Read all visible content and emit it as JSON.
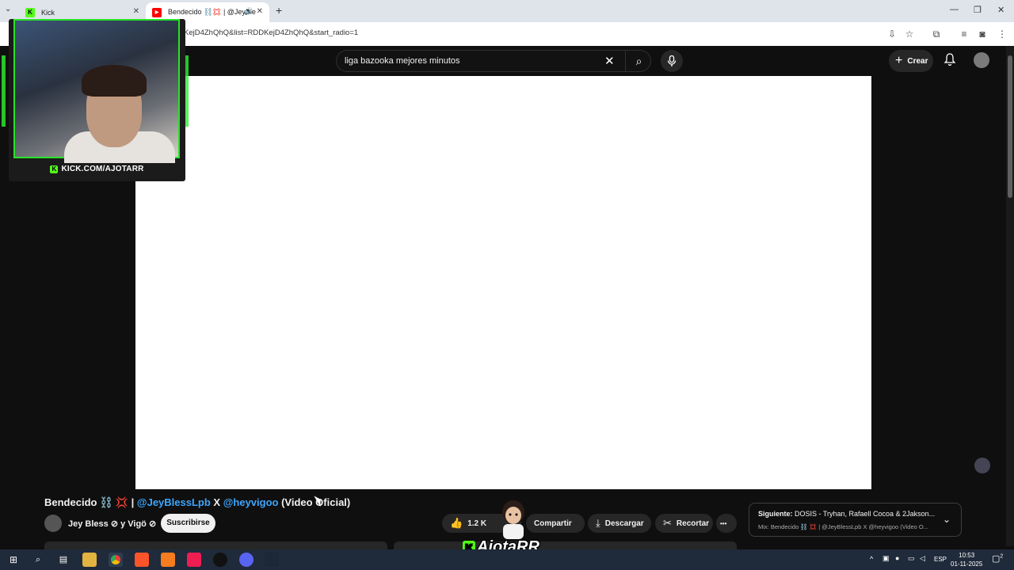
{
  "browser": {
    "tabs": [
      {
        "label": "Kick",
        "favicon": "K"
      },
      {
        "label": "Bendecido ⛓️💢 | @JeyBle",
        "favicon": "▶"
      }
    ],
    "new_tab": "+",
    "url": "KejD4ZhQhQ&list=RDDKejD4ZhQhQ&start_radio=1",
    "window_controls": {
      "minimize": "—",
      "restore": "❐",
      "close": "✕"
    }
  },
  "yt_header": {
    "search_value": "liga bazooka mejores minutos",
    "clear_icon": "✕",
    "search_icon": "⌕",
    "mic_icon": "🎤",
    "create_label": "Crear",
    "create_icon": "+",
    "bell_icon": "🔔"
  },
  "webcam": {
    "url_text": "KICK.COM/AJOTARR",
    "kick_letter": "K"
  },
  "video": {
    "title_prefix": "Bendecido ⛓️ 💢 | ",
    "mention1": "@JeyBlessLpb",
    "title_mid": " X ",
    "mention2": "@heyvigoo",
    "title_suffix": " (Video Oficial)",
    "channel": "Jey Bless ⊘ y Vigö ⊘",
    "subscribe_label": "Suscribirse",
    "likes": "1.2 K",
    "share_label": "Compartir",
    "download_label": "Descargar",
    "clip_label": "Recortar",
    "more_icon": "•••"
  },
  "next_up": {
    "label_bold": "Siguiente: ",
    "label": "DOSIS - Tryhan, Rafaell Cocoa & 2Jakson...",
    "sub": "Mix: Bendecido ⛓️ 💢 | @JeyBlessLpb X @heyvigoo (Video O..."
  },
  "overlay": {
    "brand": "AjotaRR",
    "kick_letter": "K"
  },
  "taskbar": {
    "lang": "ESP",
    "time": "10:53",
    "date": "01-11-2025",
    "notif_count": "2"
  },
  "colors": {
    "yt_bg": "#0f0f0f",
    "kick_green": "#53fc18",
    "link_blue": "#3ea6ff"
  }
}
